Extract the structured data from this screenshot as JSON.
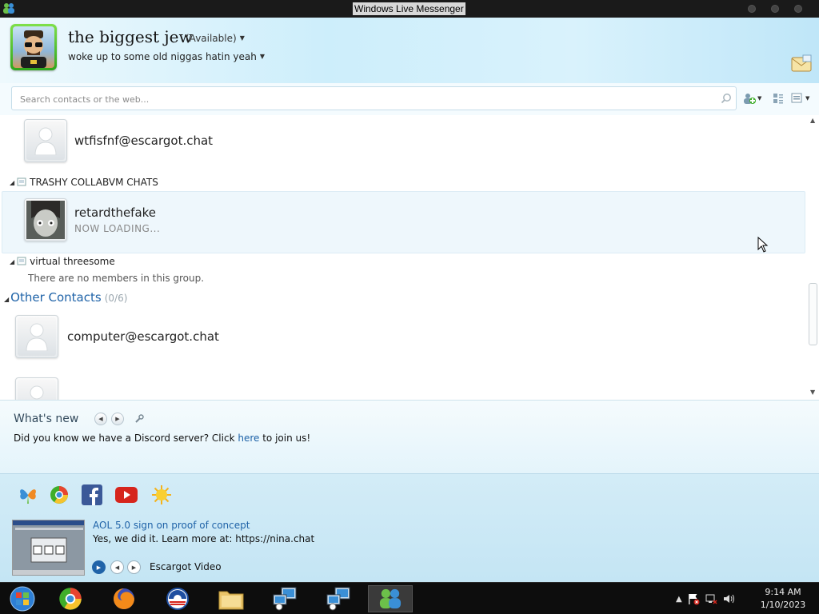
{
  "window": {
    "title": "Windows Live Messenger"
  },
  "profile": {
    "display_name": "the biggest jew",
    "status": "(Available)",
    "personal_message": "woke up to some old niggas hatin yeah"
  },
  "search": {
    "placeholder": "Search contacts or the web..."
  },
  "contacts": {
    "top_contact": {
      "name": "wtfisfnf@escargot.chat"
    },
    "groups": [
      {
        "name": "TRASHY COLLABVM CHATS",
        "members": [
          {
            "name": "retardthefake",
            "status": "NOW LOADING..."
          }
        ]
      },
      {
        "name": "virtual threesome",
        "empty_text": "There are no members in this group."
      }
    ],
    "other": {
      "label": "Other Contacts",
      "count": "(0/6)",
      "members": [
        {
          "name": "computer@escargot.chat"
        }
      ]
    }
  },
  "whats_new": {
    "title": "What's new",
    "text_before": "Did you know we have a Discord server? Click ",
    "link": "here",
    "text_after": " to join us!"
  },
  "news": {
    "headline": "AOL 5.0 sign on proof of concept",
    "body": "Yes, we did it. Learn more at: https://nina.chat",
    "video_label": "Escargot Video"
  },
  "clock": {
    "time": "9:14 AM",
    "date": "1/10/2023"
  }
}
